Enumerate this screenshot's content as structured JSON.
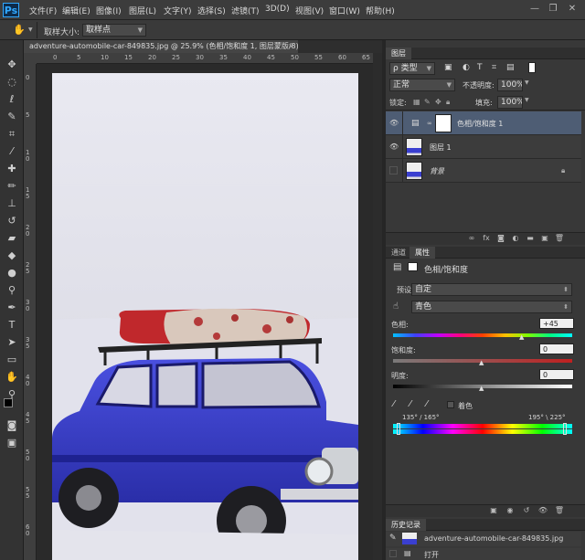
{
  "app": {
    "logo": "Ps"
  },
  "menu": [
    "文件(F)",
    "编辑(E)",
    "图像(I)",
    "图层(L)",
    "文字(Y)",
    "选择(S)",
    "滤镜(T)",
    "3D(D)",
    "视图(V)",
    "窗口(W)",
    "帮助(H)"
  ],
  "window_controls": {
    "minimize": "—",
    "restore": "❐",
    "close": "✕"
  },
  "options": {
    "sample_size_label": "取样大小:",
    "sample_size_value": "取样点"
  },
  "document": {
    "tab_title": "adventure-automobile-car-849835.jpg @ 25.9% (色相/饱和度 1, 图层蒙版/8) *",
    "tab_close": "×",
    "ruler_h": [
      "0",
      "5",
      "10",
      "15",
      "20",
      "25",
      "30",
      "35",
      "40",
      "45",
      "50",
      "55",
      "60",
      "65"
    ],
    "ruler_v": [
      "0",
      "5",
      "1 0",
      "1 5",
      "2 0",
      "2 5",
      "3 0",
      "3 5",
      "4 0",
      "4 5",
      "5 0",
      "5 5",
      "6 0"
    ]
  },
  "layers_panel": {
    "title": "图层",
    "filter_value": "ρ 类型",
    "blend_mode": "正常",
    "opacity_label": "不透明度:",
    "opacity_value": "100%",
    "lock_label": "锁定:",
    "fill_label": "填充:",
    "fill_value": "100%",
    "layers": [
      {
        "name": "色相/饱和度 1",
        "visible": true
      },
      {
        "name": "图层 1",
        "visible": true
      },
      {
        "name": "背景",
        "visible": false
      }
    ]
  },
  "properties_panel": {
    "tabs": [
      "通道",
      "属性"
    ],
    "header": "色相/饱和度",
    "preset_label": "预设:",
    "preset_value": "自定",
    "channel_value": "青色",
    "hue_label": "色相:",
    "hue_value": "+45",
    "saturation_label": "饱和度:",
    "saturation_value": "0",
    "lightness_label": "明度:",
    "lightness_value": "0",
    "colorize_label": "着色",
    "range_left": "135° / 165°",
    "range_right": "195° \\ 225°"
  },
  "history_panel": {
    "title": "历史记录",
    "snapshot": "adventure-automobile-car-849835.jpg",
    "items": [
      "打开"
    ]
  },
  "colors": {
    "accent": "#31a8ff",
    "car_blue": "#3a3fd0",
    "luggage_red": "#c0282c"
  }
}
